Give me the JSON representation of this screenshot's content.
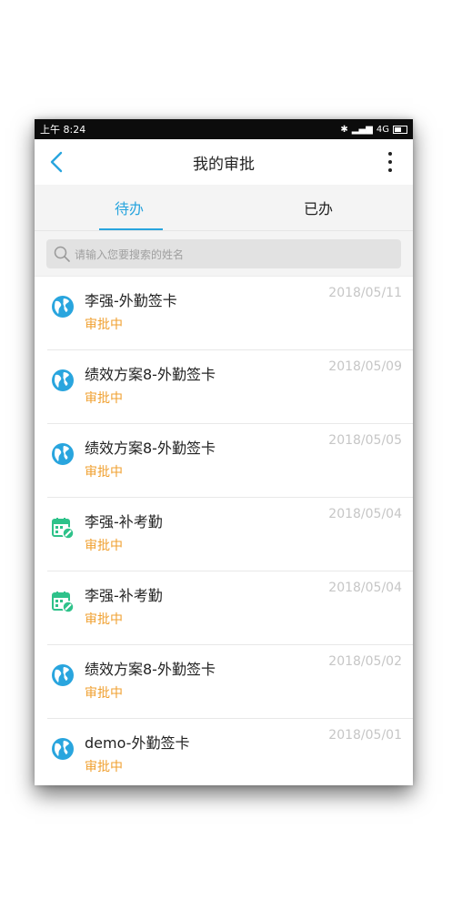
{
  "statusbar": {
    "time": "上午 8:24",
    "network": "4G"
  },
  "header": {
    "title": "我的审批"
  },
  "tabs": [
    {
      "label": "待办",
      "active": true
    },
    {
      "label": "已办",
      "active": false
    }
  ],
  "search": {
    "placeholder": "请输入您要搜索的姓名"
  },
  "items": [
    {
      "title": "李强-外勤签卡",
      "status": "审批中",
      "date": "2018/05/11",
      "icon": "globe-icon"
    },
    {
      "title": "绩效方案8-外勤签卡",
      "status": "审批中",
      "date": "2018/05/09",
      "icon": "globe-icon"
    },
    {
      "title": "绩效方案8-外勤签卡",
      "status": "审批中",
      "date": "2018/05/05",
      "icon": "globe-icon"
    },
    {
      "title": "李强-补考勤",
      "status": "审批中",
      "date": "2018/05/04",
      "icon": "calendar-edit-icon"
    },
    {
      "title": "李强-补考勤",
      "status": "审批中",
      "date": "2018/05/04",
      "icon": "calendar-edit-icon"
    },
    {
      "title": "绩效方案8-外勤签卡",
      "status": "审批中",
      "date": "2018/05/02",
      "icon": "globe-icon"
    },
    {
      "title": "demo-外勤签卡",
      "status": "审批中",
      "date": "2018/05/01",
      "icon": "globe-icon"
    }
  ],
  "colors": {
    "accent": "#29a5de",
    "status": "#f0a030",
    "calendar": "#2ec28a"
  }
}
